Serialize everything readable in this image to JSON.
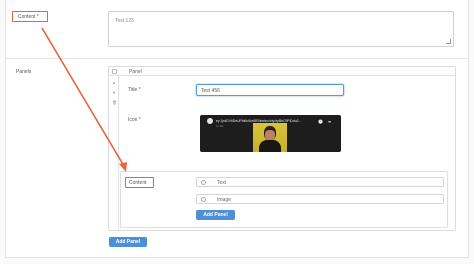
{
  "fields": {
    "content_label": "Content *",
    "content_value": "Test 123",
    "panels_label": "Panels"
  },
  "panel": {
    "header_title": "Panel",
    "title_label": "Title *",
    "title_value": "Test 456",
    "icon_label": "Icon *",
    "video": {
      "title": "ey JpdGVtIDeUFIbiIkIUe6RStmdnc/vIy/dpBbC9FIDdu2...",
      "subtitle": "1 min"
    },
    "nested_content_label": "Content",
    "options": [
      "Text",
      "Image"
    ],
    "add_panel_inner_label": "Add Panel"
  },
  "add_panel_outer_label": "Add Panel",
  "colors": {
    "highlight": "#e8633d",
    "button": "#4e90d6",
    "focus": "#5b9bd5"
  }
}
